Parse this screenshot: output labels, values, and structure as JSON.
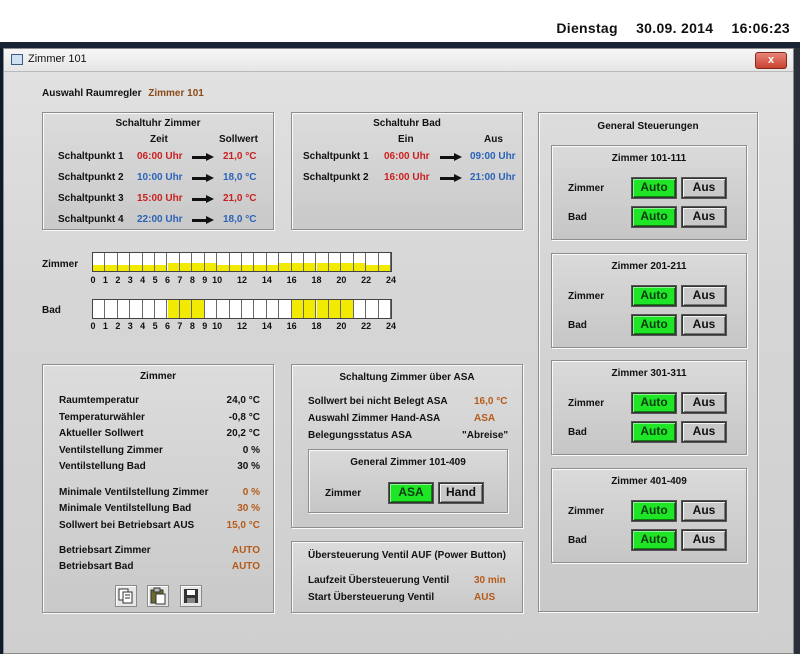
{
  "topbar": {
    "day": "Dienstag",
    "date": "30.09. 2014",
    "time": "16:06:23"
  },
  "window": {
    "title": "Zimmer 101",
    "close_label": "x"
  },
  "header": {
    "label": "Auswahl Raumregler",
    "value": "Zimmer 101"
  },
  "schaltuhr_zimmer": {
    "title": "Schaltuhr Zimmer",
    "col_zeit": "Zeit",
    "col_sollwert": "Sollwert",
    "rows": [
      {
        "label": "Schaltpunkt 1",
        "time": "06:00 Uhr",
        "value": "21,0 °C",
        "color": "red"
      },
      {
        "label": "Schaltpunkt 2",
        "time": "10:00 Uhr",
        "value": "18,0 °C",
        "color": "blue"
      },
      {
        "label": "Schaltpunkt 3",
        "time": "15:00 Uhr",
        "value": "21,0 °C",
        "color": "red"
      },
      {
        "label": "Schaltpunkt 4",
        "time": "22:00 Uhr",
        "value": "18,0 °C",
        "color": "blue"
      }
    ]
  },
  "schaltuhr_bad": {
    "title": "Schaltuhr Bad",
    "col_ein": "Ein",
    "col_aus": "Aus",
    "rows": [
      {
        "label": "Schaltpunkt 1",
        "ein": "06:00 Uhr",
        "aus": "09:00 Uhr"
      },
      {
        "label": "Schaltpunkt 2",
        "ein": "16:00 Uhr",
        "aus": "21:00 Uhr"
      }
    ]
  },
  "timeline": {
    "zimmer_label": "Zimmer",
    "bad_label": "Bad",
    "ticks": [
      "0",
      "1",
      "2",
      "3",
      "4",
      "5",
      "6",
      "7",
      "8",
      "9",
      "10",
      "12",
      "14",
      "16",
      "18",
      "20",
      "22",
      "24"
    ],
    "zimmer_levels": [
      0.35,
      0.35,
      0.35,
      0.35,
      0.35,
      0.35,
      0.45,
      0.45,
      0.45,
      0.45,
      0.35,
      0.35,
      0.35,
      0.35,
      0.35,
      0.45,
      0.45,
      0.45,
      0.45,
      0.45,
      0.45,
      0.45,
      0.35,
      0.35
    ],
    "bad_active": [
      0,
      0,
      0,
      0,
      0,
      0,
      1,
      1,
      1,
      0,
      0,
      0,
      0,
      0,
      0,
      0,
      1,
      1,
      1,
      1,
      1,
      0,
      0,
      0
    ],
    "fill_color": "#f2ea00"
  },
  "zimmer_panel": {
    "title": "Zimmer",
    "rows": [
      {
        "label": "Raumtemperatur",
        "value": "24,0 °C",
        "color": "blk"
      },
      {
        "label": "Temperaturwähler",
        "value": "-0,8 °C",
        "color": "blk"
      },
      {
        "label": "Aktueller Sollwert",
        "value": "20,2 °C",
        "color": "blk"
      },
      {
        "label": "Ventilstellung Zimmer",
        "value": "0 %",
        "color": "blk"
      },
      {
        "label": "Ventilstellung Bad",
        "value": "30 %",
        "color": "blk"
      },
      {
        "label": "Minimale Ventilstellung Zimmer",
        "value": "0 %",
        "color": "brown"
      },
      {
        "label": "Minimale Ventilstellung Bad",
        "value": "30 %",
        "color": "brown"
      },
      {
        "label": "Sollwert bei Betriebsart AUS",
        "value": "15,0 °C",
        "color": "brown"
      },
      {
        "label": "Betriebsart Zimmer",
        "value": "AUTO",
        "color": "brown"
      },
      {
        "label": "Betriebsart Bad",
        "value": "AUTO",
        "color": "brown"
      }
    ]
  },
  "asa_panel": {
    "title": "Schaltung Zimmer über ASA",
    "rows": [
      {
        "label": "Sollwert bei nicht Belegt ASA",
        "value": "16,0 °C"
      },
      {
        "label": "Auswahl Zimmer Hand-ASA",
        "value": "ASA"
      },
      {
        "label": "Belegungsstatus ASA",
        "value": "\"Abreise\""
      }
    ],
    "general": {
      "title": "General Zimmer 101-409",
      "label": "Zimmer",
      "btn_asa": "ASA",
      "btn_hand": "Hand"
    }
  },
  "override_panel": {
    "title": "Übersteuerung Ventil AUF (Power Button)",
    "rows": [
      {
        "label": "Laufzeit Übersteuerung Ventil",
        "value": "30 min"
      },
      {
        "label": "Start Übersteuerung Ventil",
        "value": "AUS"
      }
    ]
  },
  "general_panel": {
    "title": "General Steuerungen",
    "groups": [
      {
        "title": "Zimmer 101-111",
        "row1": "Zimmer",
        "row2": "Bad",
        "auto": "Auto",
        "aus": "Aus"
      },
      {
        "title": "Zimmer 201-211",
        "row1": "Zimmer",
        "row2": "Bad",
        "auto": "Auto",
        "aus": "Aus"
      },
      {
        "title": "Zimmer 301-311",
        "row1": "Zimmer",
        "row2": "Bad",
        "auto": "Auto",
        "aus": "Aus"
      },
      {
        "title": "Zimmer 401-409",
        "row1": "Zimmer",
        "row2": "Bad",
        "auto": "Auto",
        "aus": "Aus"
      }
    ]
  },
  "toolbar": {
    "icons": [
      "copy-icon",
      "paste-icon",
      "save-icon"
    ]
  }
}
